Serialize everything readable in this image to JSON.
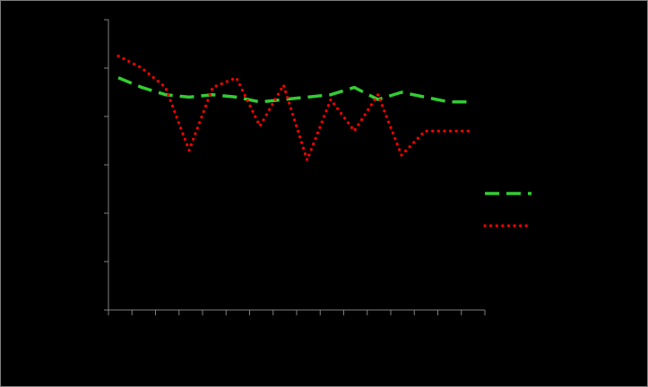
{
  "chart_data": {
    "type": "line",
    "title": "",
    "xlabel": "",
    "ylabel": "",
    "categories": [
      "",
      "",
      "",
      "",
      "",
      "",
      "",
      "",
      "",
      "",
      "",
      "",
      "",
      "",
      "",
      ""
    ],
    "ylim": [
      0,
      6
    ],
    "grid": false,
    "legend": "right",
    "series": [
      {
        "color": "#33cc33",
        "dash": "dashed",
        "values": [
          4.8,
          4.6,
          4.45,
          4.4,
          4.45,
          4.4,
          4.3,
          4.35,
          4.4,
          4.45,
          4.6,
          4.35,
          4.5,
          4.4,
          4.3,
          4.3
        ]
      },
      {
        "color": "#ff0000",
        "dash": "dotted",
        "values": [
          5.25,
          5.0,
          4.6,
          3.3,
          4.6,
          4.8,
          3.8,
          4.65,
          3.1,
          4.35,
          3.7,
          4.45,
          3.2,
          3.7,
          3.7,
          3.7
        ]
      }
    ]
  }
}
